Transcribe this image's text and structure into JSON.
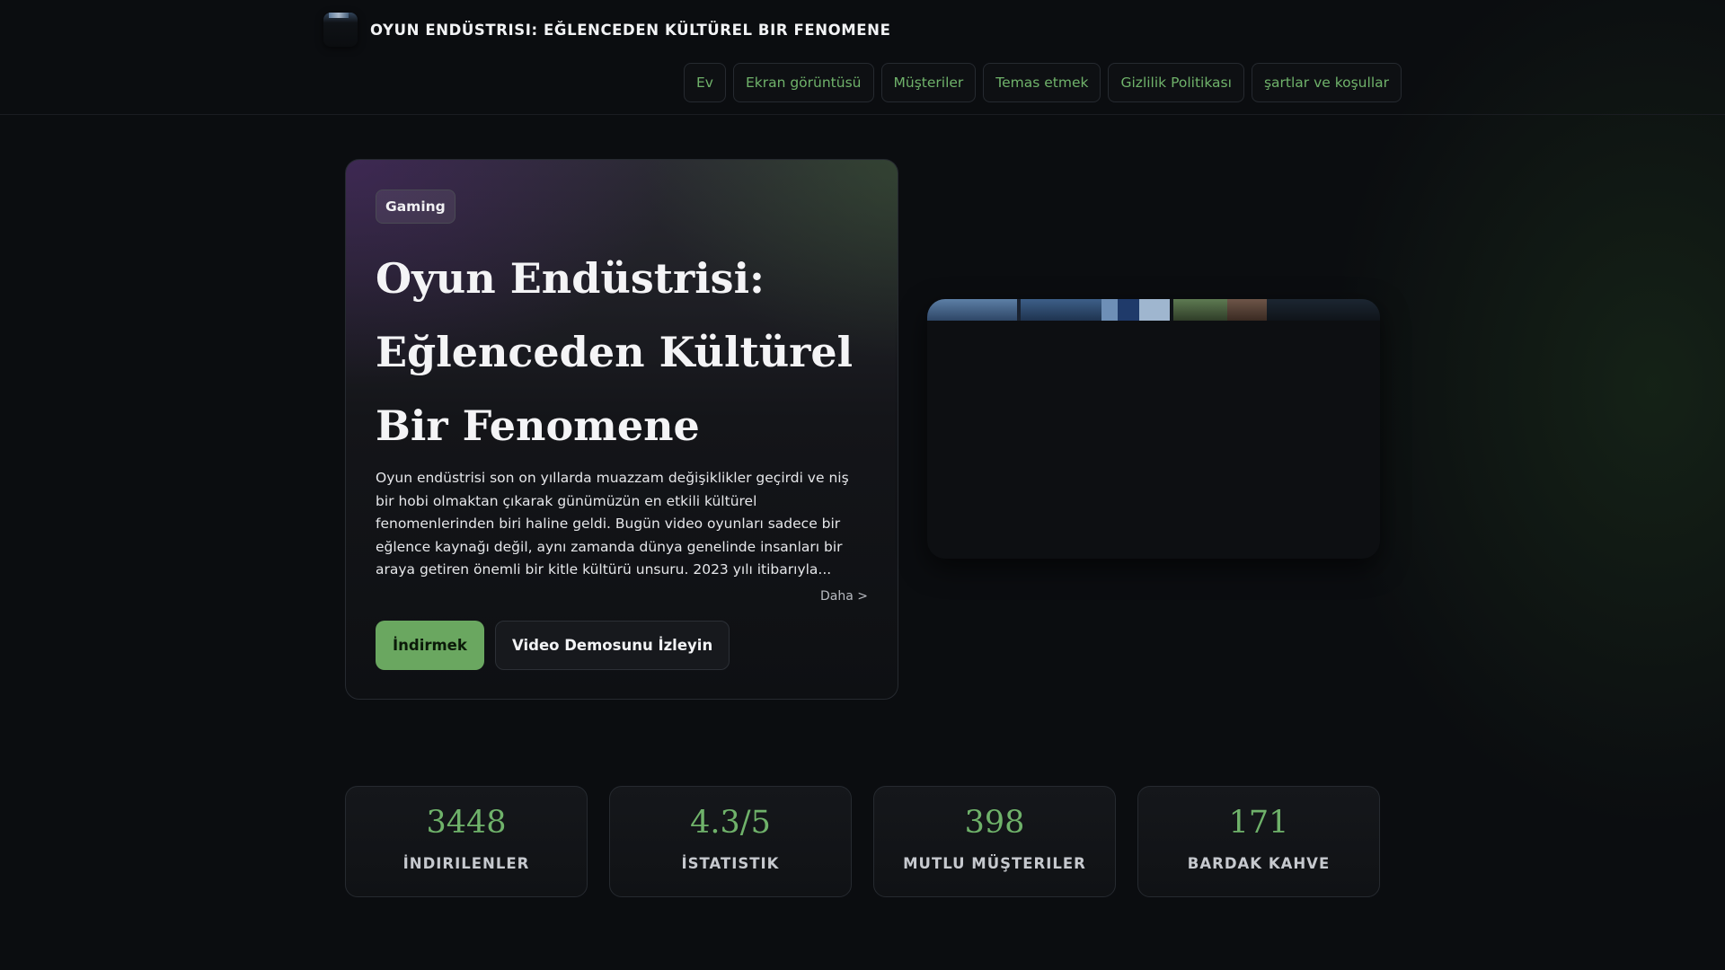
{
  "header": {
    "site_title": "OYUN ENDÜSTRISI: EĞLENCEDEN KÜLTÜREL BIR FENOMENE",
    "nav": [
      {
        "label": "Ev"
      },
      {
        "label": "Ekran görüntüsü"
      },
      {
        "label": "Müşteriler"
      },
      {
        "label": "Temas etmek"
      },
      {
        "label": "Gizlilik Politikası"
      },
      {
        "label": "şartlar ve koşullar"
      }
    ]
  },
  "hero": {
    "tag": "Gaming",
    "title": "Oyun Endüstrisi: Eğlenceden Kültürel Bir Fenomene",
    "description": "Oyun endüstrisi son on yıllarda muazzam değişiklikler geçirdi ve niş bir hobi olmaktan çıkarak günümüzün en etkili kültürel fenomenlerinden biri haline geldi. Bugün video oyunları sadece bir eğlence kaynağı değil, aynı zamanda dünya genelinde insanları bir araya getiren önemli bir kitle kültürü unsuru. 2023 yılı itibarıyla...",
    "more_link": "Daha >",
    "primary_button": "İndirmek",
    "secondary_button": "Video Demosunu İzleyin"
  },
  "stats": [
    {
      "value": "3448",
      "label": "İNDIRILENLER"
    },
    {
      "value": "4.3/5",
      "label": "İSTATISTIK"
    },
    {
      "value": "398",
      "label": "MUTLU MÜŞTERILER"
    },
    {
      "value": "171",
      "label": "BARDAK KAHVE"
    }
  ],
  "colors": {
    "accent": "#6aa760",
    "nav_text": "#6fb26a",
    "background": "#0b0d10"
  }
}
